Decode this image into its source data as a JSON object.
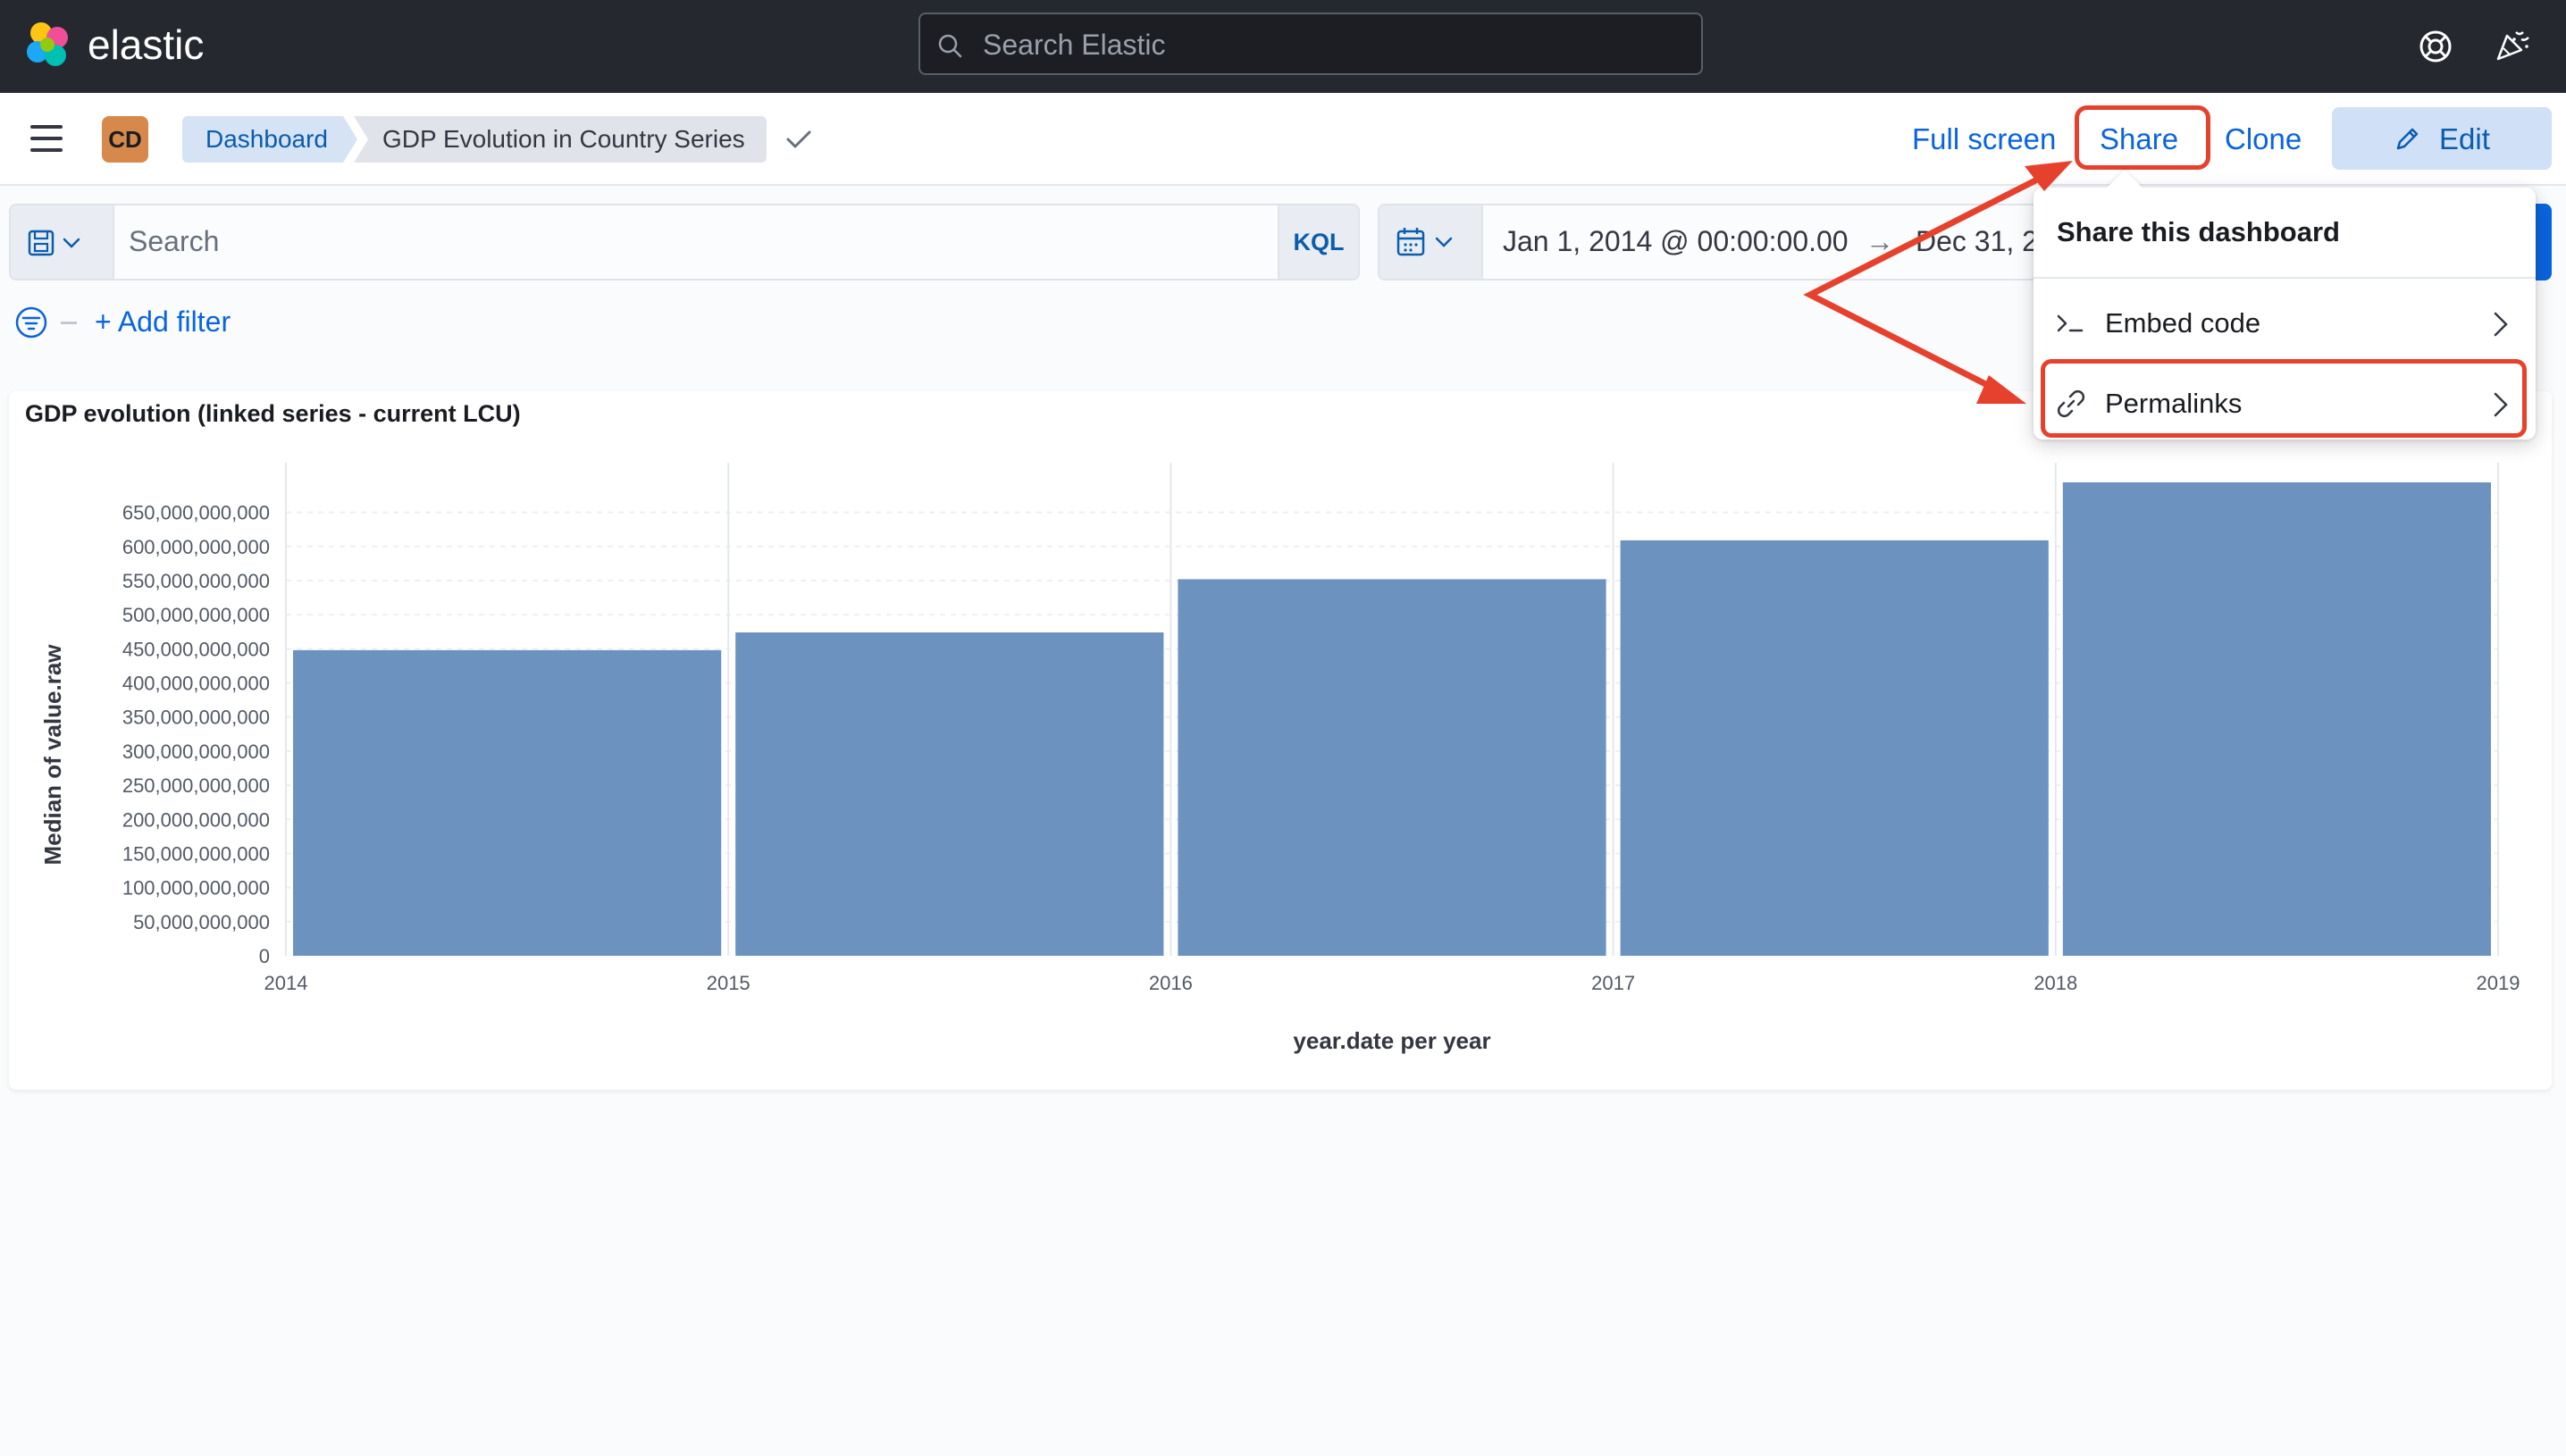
{
  "header": {
    "brand": "elastic",
    "search_placeholder": "Search Elastic"
  },
  "appbar": {
    "avatar_initials": "CD",
    "breadcrumbs": [
      "Dashboard",
      "GDP Evolution in Country Series"
    ],
    "actions": {
      "full_screen": "Full screen",
      "share": "Share",
      "clone": "Clone",
      "edit": "Edit"
    }
  },
  "query": {
    "search_placeholder": "Search",
    "language": "KQL",
    "date_start": "Jan 1, 2014 @ 00:00:00.00",
    "date_arrow": "→",
    "date_end_visible": "Dec 31, 2",
    "add_filter": "+ Add filter"
  },
  "share_menu": {
    "title": "Share this dashboard",
    "items": [
      {
        "label": "Embed code",
        "icon": "console-icon"
      },
      {
        "label": "Permalinks",
        "icon": "link-icon"
      }
    ]
  },
  "colors": {
    "bar": "#6c92bf",
    "accent": "#0b64dd",
    "annotation": "#e6412c",
    "header_bg": "#25282f"
  },
  "panel": {
    "title": "GDP evolution (linked series - current LCU)"
  },
  "chart_data": {
    "type": "bar",
    "title": "GDP evolution (linked series - current LCU)",
    "xlabel": "year.date per year",
    "ylabel": "Median of value.raw",
    "x_ticks": [
      "2014",
      "2015",
      "2016",
      "2017",
      "2018",
      "2019"
    ],
    "categories": [
      "2014",
      "2015",
      "2016",
      "2017",
      "2018"
    ],
    "values": [
      448000000000,
      474000000000,
      552000000000,
      609000000000,
      694000000000
    ],
    "y_ticks": [
      "0",
      "50,000,000,000",
      "100,000,000,000",
      "150,000,000,000",
      "200,000,000,000",
      "250,000,000,000",
      "300,000,000,000",
      "350,000,000,000",
      "400,000,000,000",
      "450,000,000,000",
      "500,000,000,000",
      "550,000,000,000",
      "600,000,000,000",
      "650,000,000,000"
    ],
    "y_tick_values": [
      0,
      50000000000,
      100000000000,
      150000000000,
      200000000000,
      250000000000,
      300000000000,
      350000000000,
      400000000000,
      450000000000,
      500000000000,
      550000000000,
      600000000000,
      650000000000
    ],
    "ylim": [
      0,
      694000000000
    ],
    "grid": true,
    "legend": "none"
  }
}
